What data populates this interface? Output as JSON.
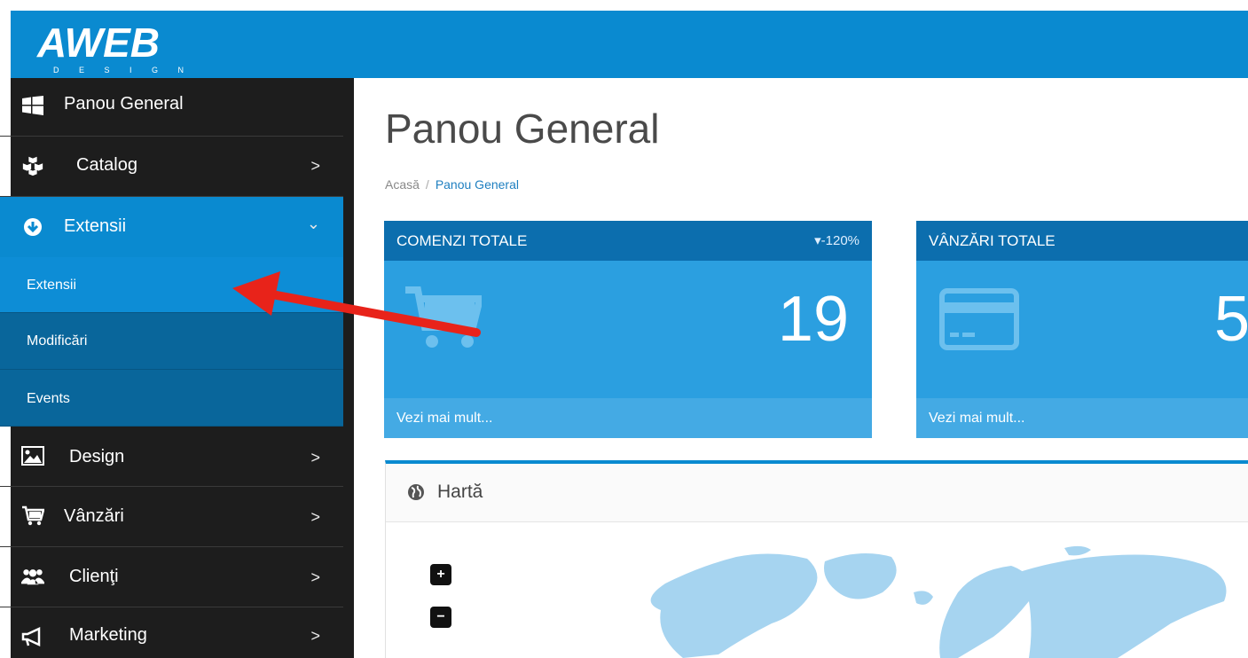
{
  "brand": {
    "logo_text": "AWEB",
    "logo_sub": "D E S I G N"
  },
  "sidebar": {
    "items": [
      {
        "label": "Panou General",
        "icon": "windows-icon"
      },
      {
        "label": "Catalog",
        "icon": "cubes-icon",
        "chevron": ">"
      },
      {
        "label": "Extensii",
        "icon": "arrow-down-circle-icon",
        "chevron": "⌄"
      },
      {
        "label": "Design",
        "icon": "image-icon",
        "chevron": ">"
      },
      {
        "label": "Vânzări",
        "icon": "cart-icon",
        "chevron": ">"
      },
      {
        "label": "Clienţi",
        "icon": "users-icon",
        "chevron": ">"
      },
      {
        "label": "Marketing",
        "icon": "megaphone-icon",
        "chevron": ">"
      }
    ],
    "subitems": [
      {
        "label": "Extensii"
      },
      {
        "label": "Modificări"
      },
      {
        "label": "Events"
      }
    ]
  },
  "main": {
    "title": "Panou General",
    "breadcrumb": {
      "home": "Acasă",
      "sep": "/",
      "current": "Panou General"
    }
  },
  "tiles": [
    {
      "title": "COMENZI TOTALE",
      "change": "-120%",
      "value": "19",
      "footer": "Vezi mai mult...",
      "icon": "shopping-cart-icon"
    },
    {
      "title": "VÂNZĂRI TOTALE",
      "change": "",
      "value": "5",
      "footer": "Vezi mai mult...",
      "icon": "credit-card-icon"
    }
  ],
  "map_panel": {
    "title": "Hartă",
    "zoom_in": "+",
    "zoom_out": "−"
  },
  "colors": {
    "topbar": "#0a8ad0",
    "sidebar": "#1d1d1d",
    "tile": "#2b9fe0",
    "tile_head": "#0c6eae",
    "annotation_arrow": "#e8231a"
  }
}
